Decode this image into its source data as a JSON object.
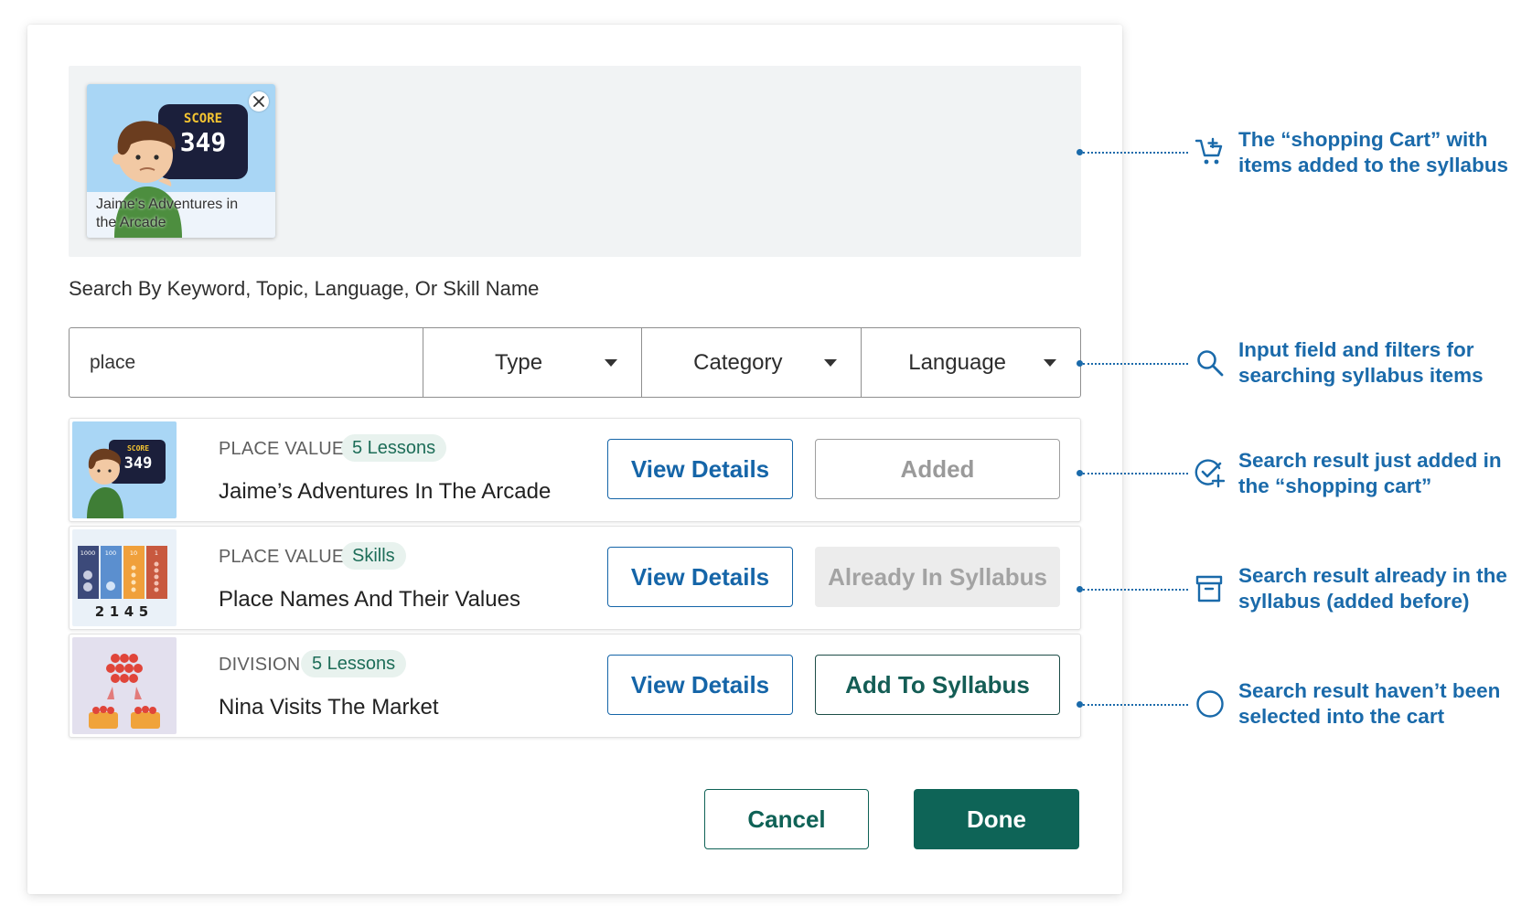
{
  "cart": {
    "items": [
      {
        "caption": "Jaime's Adventures in the Arcade",
        "score_label": "SCORE",
        "score_value": "349",
        "icon": "close-icon"
      }
    ]
  },
  "search": {
    "label": "Search By Keyword, Topic, Language, Or Skill Name",
    "value": "place",
    "filters": [
      {
        "label": "Type"
      },
      {
        "label": "Category"
      },
      {
        "label": "Language"
      }
    ]
  },
  "results": [
    {
      "category": "PLACE VALUE",
      "tag": "5 Lessons",
      "title": "Jaime’s Adventures In The Arcade",
      "view_label": "View Details",
      "action_label": "Added",
      "action_state": "added",
      "score_label": "SCORE",
      "score_value": "349"
    },
    {
      "category": "PLACE VALUE",
      "tag": "Skills",
      "title": "Place Names And Their Values",
      "view_label": "View Details",
      "action_label": "Already In Syllabus",
      "action_state": "in-syllabus",
      "columns": [
        "1000",
        "100",
        "10",
        "1"
      ],
      "digits": [
        "2",
        "1",
        "4",
        "5"
      ]
    },
    {
      "category": "DIVISION",
      "tag": "5 Lessons",
      "title": "Nina Visits The Market",
      "view_label": "View Details",
      "action_label": "Add To Syllabus",
      "action_state": "available"
    }
  ],
  "footer": {
    "cancel_label": "Cancel",
    "done_label": "Done"
  },
  "annotations": [
    {
      "text": "The “shopping Cart” with items added to the syllabus",
      "icon": "cart-plus-icon"
    },
    {
      "text": "Input field and filters for searching syllabus items",
      "icon": "search-icon"
    },
    {
      "text": "Search result just added in the “shopping cart”",
      "icon": "check-plus-icon"
    },
    {
      "text": "Search result already in the syllabus (added before)",
      "icon": "archive-icon"
    },
    {
      "text": "Search result haven’t been selected into the cart",
      "icon": "circle-icon"
    }
  ],
  "colors": {
    "primary_blue": "#1565a8",
    "brand_green": "#0e6457",
    "annotation_blue": "#1a6aaa",
    "tag_bg": "#e8f2ee"
  }
}
